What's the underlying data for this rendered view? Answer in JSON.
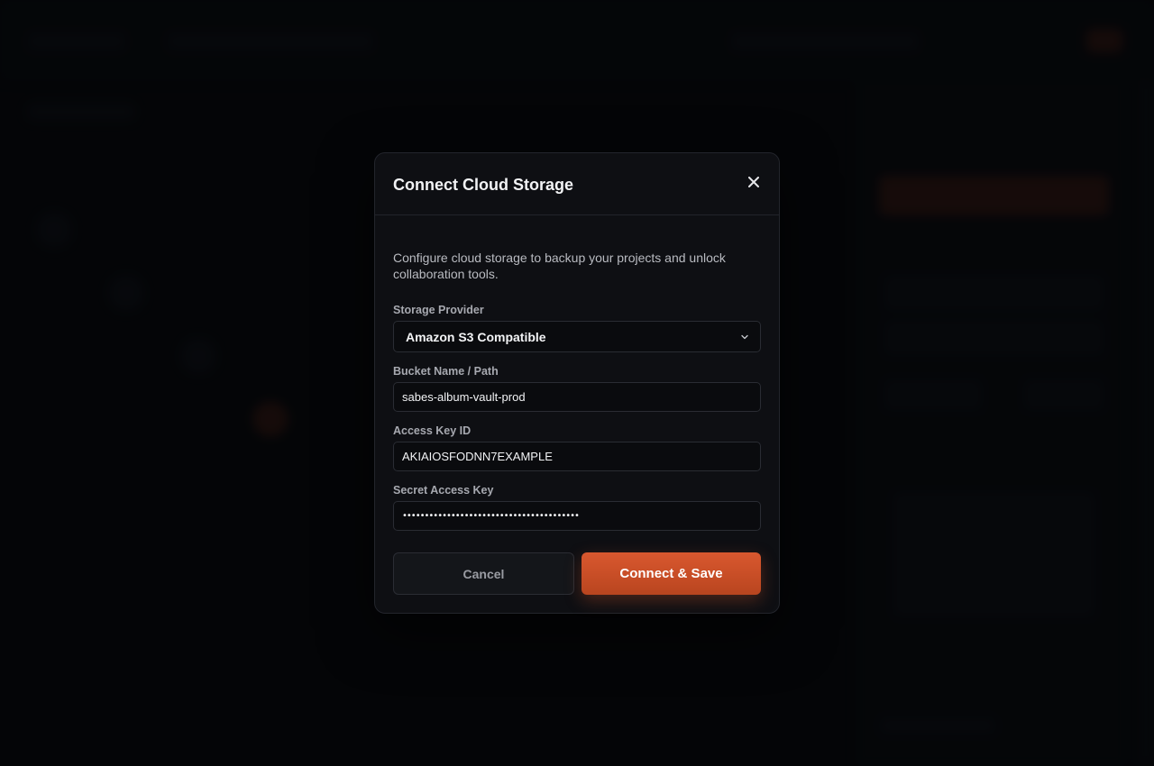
{
  "modal": {
    "title": "Connect Cloud Storage",
    "description": "Configure cloud storage to backup your projects and unlock collaboration tools.",
    "fields": {
      "provider": {
        "label": "Storage Provider",
        "value": "Amazon S3 Compatible"
      },
      "bucket": {
        "label": "Bucket Name / Path",
        "value": "sabes-album-vault-prod"
      },
      "access_key": {
        "label": "Access Key ID",
        "value": "AKIAIOSFODNN7EXAMPLE"
      },
      "secret_key": {
        "label": "Secret Access Key",
        "value": "••••••••••••••••••••••••••••••••••••••••"
      }
    },
    "buttons": {
      "cancel": "Cancel",
      "primary": "Connect & Save"
    }
  },
  "colors": {
    "accent": "#d9582f",
    "modal_bg": "#0e0f13",
    "page_bg": "#07080b"
  },
  "icons": {
    "close": "close-icon",
    "select_arrow": "chevron-down-icon"
  }
}
